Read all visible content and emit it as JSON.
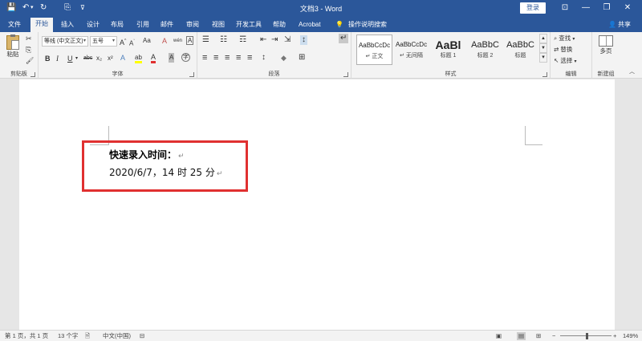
{
  "titlebar": {
    "title": "文档3  -  Word",
    "login_label": "登录",
    "qa_save": "💾",
    "qa_undo": "↶",
    "qa_undo_drop": "▾",
    "qa_redo": "↻",
    "qa_touch": "⎘",
    "qa_more": "⊽",
    "win_ribbon_opts": "⊡",
    "win_minimize": "—",
    "win_restore": "❐",
    "win_close": "✕"
  },
  "tabs": [
    "文件",
    "开始",
    "插入",
    "设计",
    "布局",
    "引用",
    "邮件",
    "审阅",
    "视图",
    "开发工具",
    "帮助",
    "Acrobat"
  ],
  "active_tab": "开始",
  "tell_me": "操作说明搜索",
  "share": "共享",
  "clipboard": {
    "label": "剪贴板",
    "paste": "粘贴",
    "cut": "✂",
    "copy": "⎘",
    "format_painter": "🖌"
  },
  "font": {
    "label": "字体",
    "font_name": "等线 (中文正文)",
    "font_size": "五号",
    "grow": "A",
    "shrink": "A",
    "case": "Aa",
    "clear": "A",
    "phonetic": "wén",
    "border_char": "A",
    "bold": "B",
    "italic": "I",
    "underline": "U",
    "strike": "abc",
    "subscript": "x₂",
    "superscript": "x²",
    "effects": "A",
    "highlight": "ab",
    "color": "A",
    "shade": "A",
    "circle": "字"
  },
  "paragraph": {
    "label": "段落",
    "bullets": "☰",
    "numbering": "☷",
    "multilevel": "☶",
    "decrease": "⇤",
    "increase": "⇥",
    "sort": "↕",
    "showmarks": "↵",
    "align_left": "≡",
    "align_center": "≡",
    "align_right": "≡",
    "justify": "≡",
    "distribute": "≡",
    "line_spacing": "↕",
    "shading": "◆",
    "borders": "⊞"
  },
  "styles": {
    "label": "样式",
    "items": [
      {
        "sample": "AaBbCcDc",
        "name": "↵ 正文"
      },
      {
        "sample": "AaBbCcDc",
        "name": "↵ 无间隔"
      },
      {
        "sample": "AaBl",
        "name": "标题 1"
      },
      {
        "sample": "AaBbC",
        "name": "标题 2"
      },
      {
        "sample": "AaBbC",
        "name": "标题"
      }
    ],
    "up": "▲",
    "down": "▼",
    "more": "▾"
  },
  "editing": {
    "label": "编辑",
    "find": "查找",
    "replace": "替换",
    "select": "选择"
  },
  "newgroup": {
    "label": "新建组",
    "multipage": "多页"
  },
  "document": {
    "line1": "快速录入时间：",
    "line2": "2020/6/7，14 时 25 分",
    "para_mark": "↵"
  },
  "statusbar": {
    "page": "第 1 页，共 1 页",
    "words": "13 个字",
    "lang": "中文(中国)",
    "zoom_minus": "−",
    "zoom_plus": "+",
    "zoom": "149%"
  },
  "colors": {
    "brand": "#2b579a",
    "ribbon": "#f3f3f3",
    "highlight_box": "#e03030"
  }
}
